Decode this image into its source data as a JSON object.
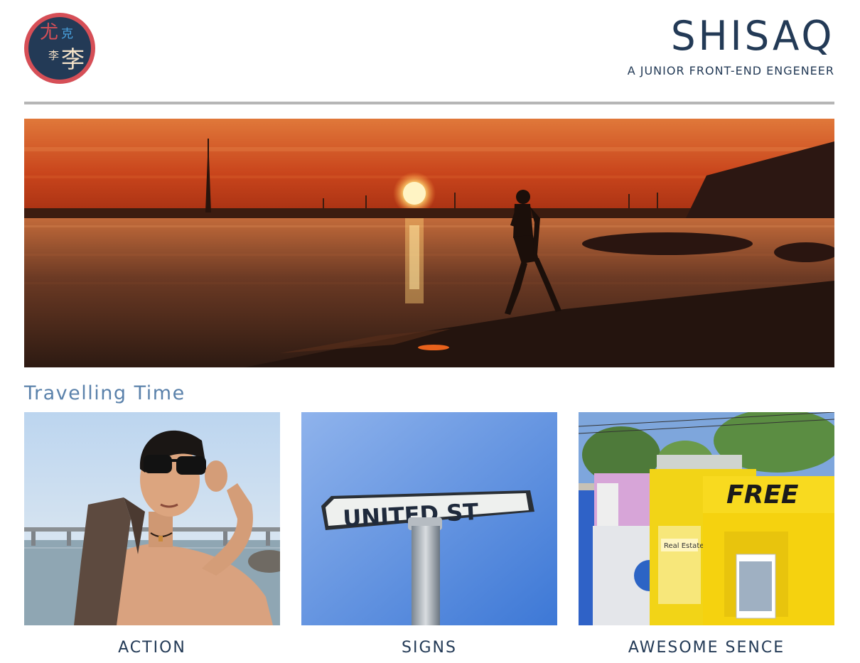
{
  "header": {
    "logo_glyphs": [
      "尤",
      "克",
      "李",
      "李"
    ],
    "title": "SHISAQ",
    "subtitle": "A JUNIOR FRONT-END ENGENEER"
  },
  "colors": {
    "primary": "#233a56",
    "accent": "#d64f57",
    "section_heading": "#5b82ab",
    "divider": "#b6b6b6"
  },
  "hero": {
    "image": "sunset-beach-photo"
  },
  "section": {
    "title": "Travelling Time"
  },
  "gallery": [
    {
      "caption": "ACTION",
      "image": "portrait-with-sunglasses-photo"
    },
    {
      "caption": "SIGNS",
      "image": "street-sign-photo",
      "sign_text": "UNITED ST"
    },
    {
      "caption": "AWESOME SENCE",
      "image": "newspaper-boxes-photo",
      "sign_text": "FREE",
      "small_text": "Real Estate"
    }
  ]
}
